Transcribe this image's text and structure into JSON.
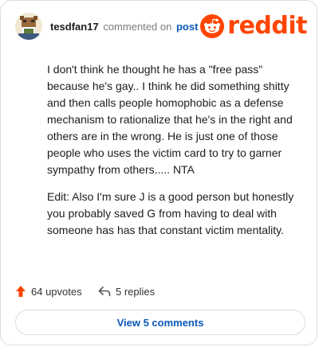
{
  "comment": {
    "username": "tesdfan17",
    "commented_on": "commented on",
    "post_link": "post",
    "body": [
      "I don't think he thought he has a \"free pass\" because he's gay.. I think he did something shitty and then calls people homophobic as a defense mechanism to rationalize that he's in the right and others are in the wrong. He is just one of those people who uses the victim card to try to garner sympathy from others..... NTA",
      "Edit: Also I'm sure J is a good person but honestly you probably saved G from having to deal with someone has has that constant victim mentality."
    ]
  },
  "brand": {
    "logo_text": "reddit",
    "color": "#ff4500"
  },
  "actions": {
    "upvotes": "64 upvotes",
    "replies": "5 replies"
  },
  "view_button": "View 5 comments",
  "icons": {
    "avatar": "user-avatar",
    "logo": "reddit-snoo-icon",
    "upvote": "upvote-arrow-icon",
    "reply": "reply-arrow-icon"
  }
}
